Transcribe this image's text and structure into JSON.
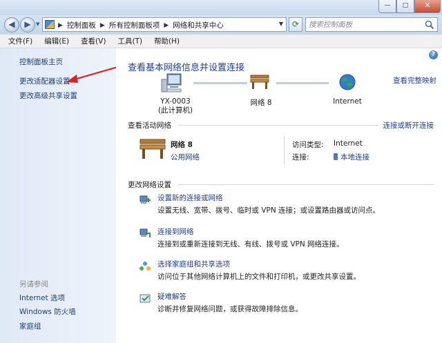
{
  "window": {
    "caption_buttons": {
      "minimize": "—",
      "maximize": "□",
      "close": "✕"
    }
  },
  "address_bar": {
    "breadcrumb": [
      "控制面板",
      "所有控制面板项",
      "网络和共享中心"
    ],
    "search_placeholder": "搜索控制面板"
  },
  "menu": [
    "文件(F)",
    "编辑(E)",
    "查看(V)",
    "工具(T)",
    "帮助(H)"
  ],
  "sidebar": {
    "items": [
      "控制面板主页",
      "更改适配器设置",
      "更改高级共享设置"
    ],
    "see_also_title": "另请参阅",
    "see_also": [
      "Internet 选项",
      "Windows 防火墙",
      "家庭组"
    ]
  },
  "main": {
    "title": "查看基本网络信息并设置连接",
    "view_full_map": "查看完整映射",
    "map": {
      "computer_name": "YX-0003",
      "computer_sub": "(此计算机)",
      "network": "网络  8",
      "internet": "Internet"
    },
    "active_title": "查看活动网络",
    "connect_disconnect": "连接或断开连接",
    "active_network": {
      "name": "网络  8",
      "type": "公用网络",
      "access_type_key": "访问类型:",
      "access_type_value": "Internet",
      "connection_key": "连接:",
      "connection_value": "本地连接"
    },
    "change_title": "更改网络设置",
    "tasks": [
      {
        "link": "设置新的连接或网络",
        "desc": "设置无线、宽带、拨号、临时或 VPN 连接；或设置路由器或访问点。"
      },
      {
        "link": "连接到网络",
        "desc": "连接到或重新连接到无线、有线、拨号或 VPN 网络连接。"
      },
      {
        "link": "选择家庭组和共享选项",
        "desc": "访问位于其他网络计算机上的文件和打印机，或更改共享设置。"
      },
      {
        "link": "疑难解答",
        "desc": "诊断并修复网络问题，或获得故障排除信息。"
      }
    ]
  }
}
